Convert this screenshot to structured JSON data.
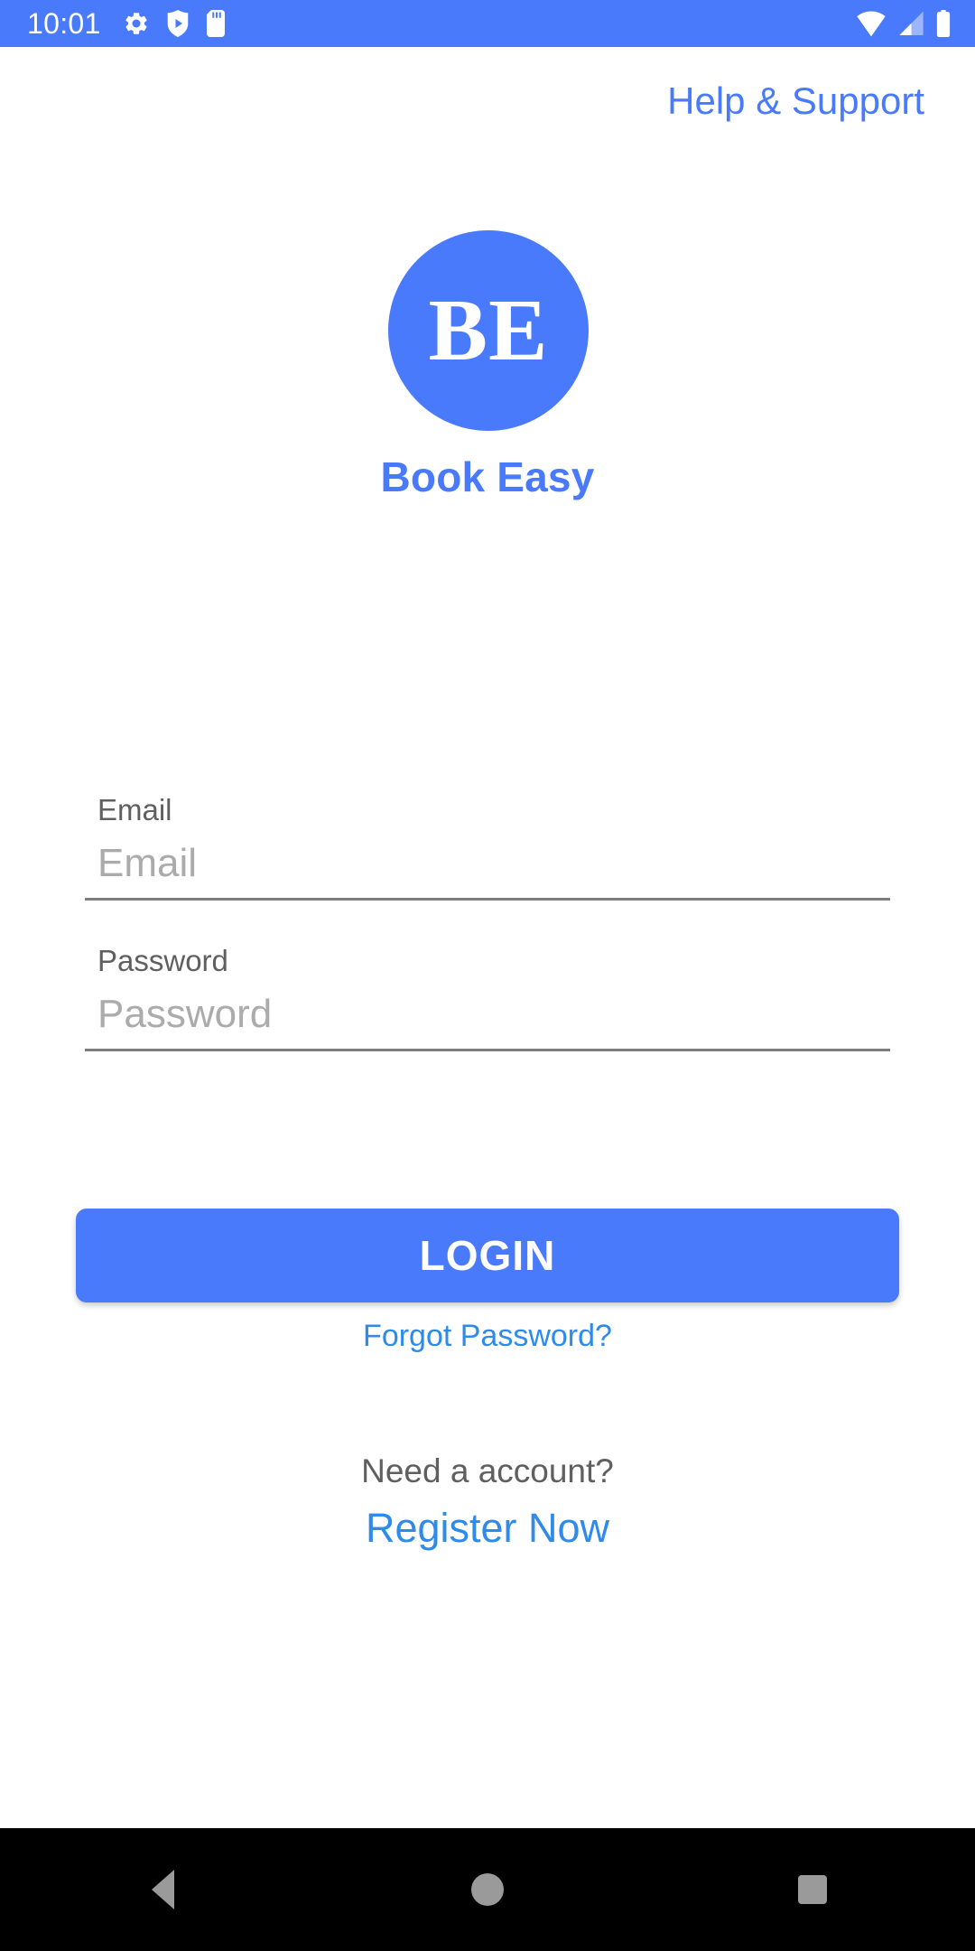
{
  "status_bar": {
    "time": "10:01",
    "background_color": "#4a7afc",
    "left_icons": [
      "gear-icon",
      "shield-play-icon",
      "sd-card-icon"
    ],
    "right_icons": [
      "wifi-icon",
      "cellular-signal-icon",
      "battery-icon"
    ]
  },
  "header": {
    "help_support_label": "Help & Support",
    "link_color": "#4a7afc"
  },
  "brand": {
    "monogram": "BE",
    "app_name": "Book Easy",
    "circle_color": "#4a7afc",
    "monogram_color": "#ffffff",
    "wordmark_color": "#4a7afc"
  },
  "form": {
    "fields": [
      {
        "label": "Email",
        "placeholder": "Email",
        "value": "",
        "type": "email",
        "name": "email-field"
      },
      {
        "label": "Password",
        "placeholder": "Password",
        "value": "",
        "type": "password",
        "name": "password-field"
      }
    ]
  },
  "actions": {
    "login_label": "LOGIN",
    "login_color": "#4a7afc",
    "forgot_password_label": "Forgot Password?",
    "register_prompt": "Need a account?",
    "register_label": "Register Now",
    "link_color": "#2e8bea"
  },
  "nav_bar": {
    "background_color": "#000000",
    "icon_color": "#9a9a9a",
    "buttons": [
      "back-icon",
      "home-icon",
      "recents-icon"
    ]
  }
}
